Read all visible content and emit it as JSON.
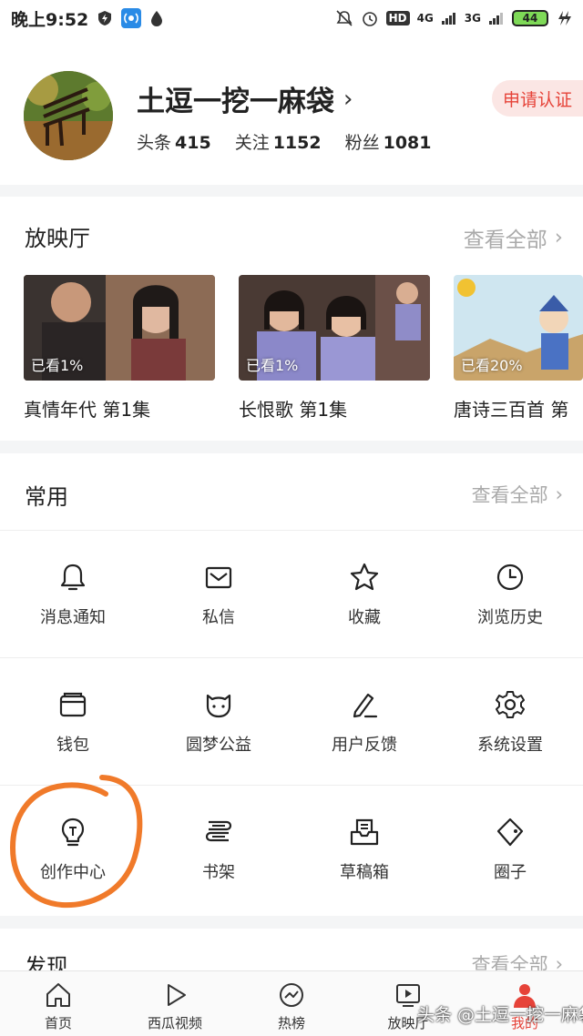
{
  "status_bar": {
    "time": "晚上9:52",
    "network_1": "4G",
    "network_2": "3G",
    "hd": "HD",
    "battery": "44"
  },
  "profile": {
    "username": "土逗一挖一麻袋",
    "stats": [
      {
        "label": "头条",
        "value": "415"
      },
      {
        "label": "关注",
        "value": "1152"
      },
      {
        "label": "粉丝",
        "value": "1081"
      }
    ],
    "apply_label": "申请认证"
  },
  "theater": {
    "title": "放映厅",
    "more_label": "查看全部",
    "videos": [
      {
        "title": "真情年代 第1集",
        "progress": "已看1%"
      },
      {
        "title": "长恨歌 第1集",
        "progress": "已看1%"
      },
      {
        "title": "唐诗三百首 第",
        "progress": "已看20%"
      }
    ]
  },
  "common": {
    "title": "常用",
    "more_label": "查看全部",
    "items": [
      {
        "label": "消息通知",
        "icon": "bell-icon"
      },
      {
        "label": "私信",
        "icon": "mail-icon"
      },
      {
        "label": "收藏",
        "icon": "star-icon"
      },
      {
        "label": "浏览历史",
        "icon": "clock-icon"
      },
      {
        "label": "钱包",
        "icon": "wallet-icon"
      },
      {
        "label": "圆梦公益",
        "icon": "cat-face-icon"
      },
      {
        "label": "用户反馈",
        "icon": "pen-icon"
      },
      {
        "label": "系统设置",
        "icon": "gear-icon"
      },
      {
        "label": "创作中心",
        "icon": "lightbulb-icon"
      },
      {
        "label": "书架",
        "icon": "books-icon"
      },
      {
        "label": "草稿箱",
        "icon": "inbox-icon"
      },
      {
        "label": "圈子",
        "icon": "circle-tag-icon"
      }
    ]
  },
  "discover": {
    "title": "发现",
    "more_label": "查看全部"
  },
  "tabbar": {
    "tabs": [
      {
        "label": "首页",
        "icon": "home-icon"
      },
      {
        "label": "西瓜视频",
        "icon": "play-icon"
      },
      {
        "label": "热榜",
        "icon": "trending-icon"
      },
      {
        "label": "放映厅",
        "icon": "screen-play-icon"
      },
      {
        "label": "我的",
        "icon": "user-icon"
      }
    ]
  },
  "watermark": "头条 @土逗一挖一麻袋",
  "colors": {
    "accent": "#e64339",
    "annotation": "#f07a2a"
  }
}
